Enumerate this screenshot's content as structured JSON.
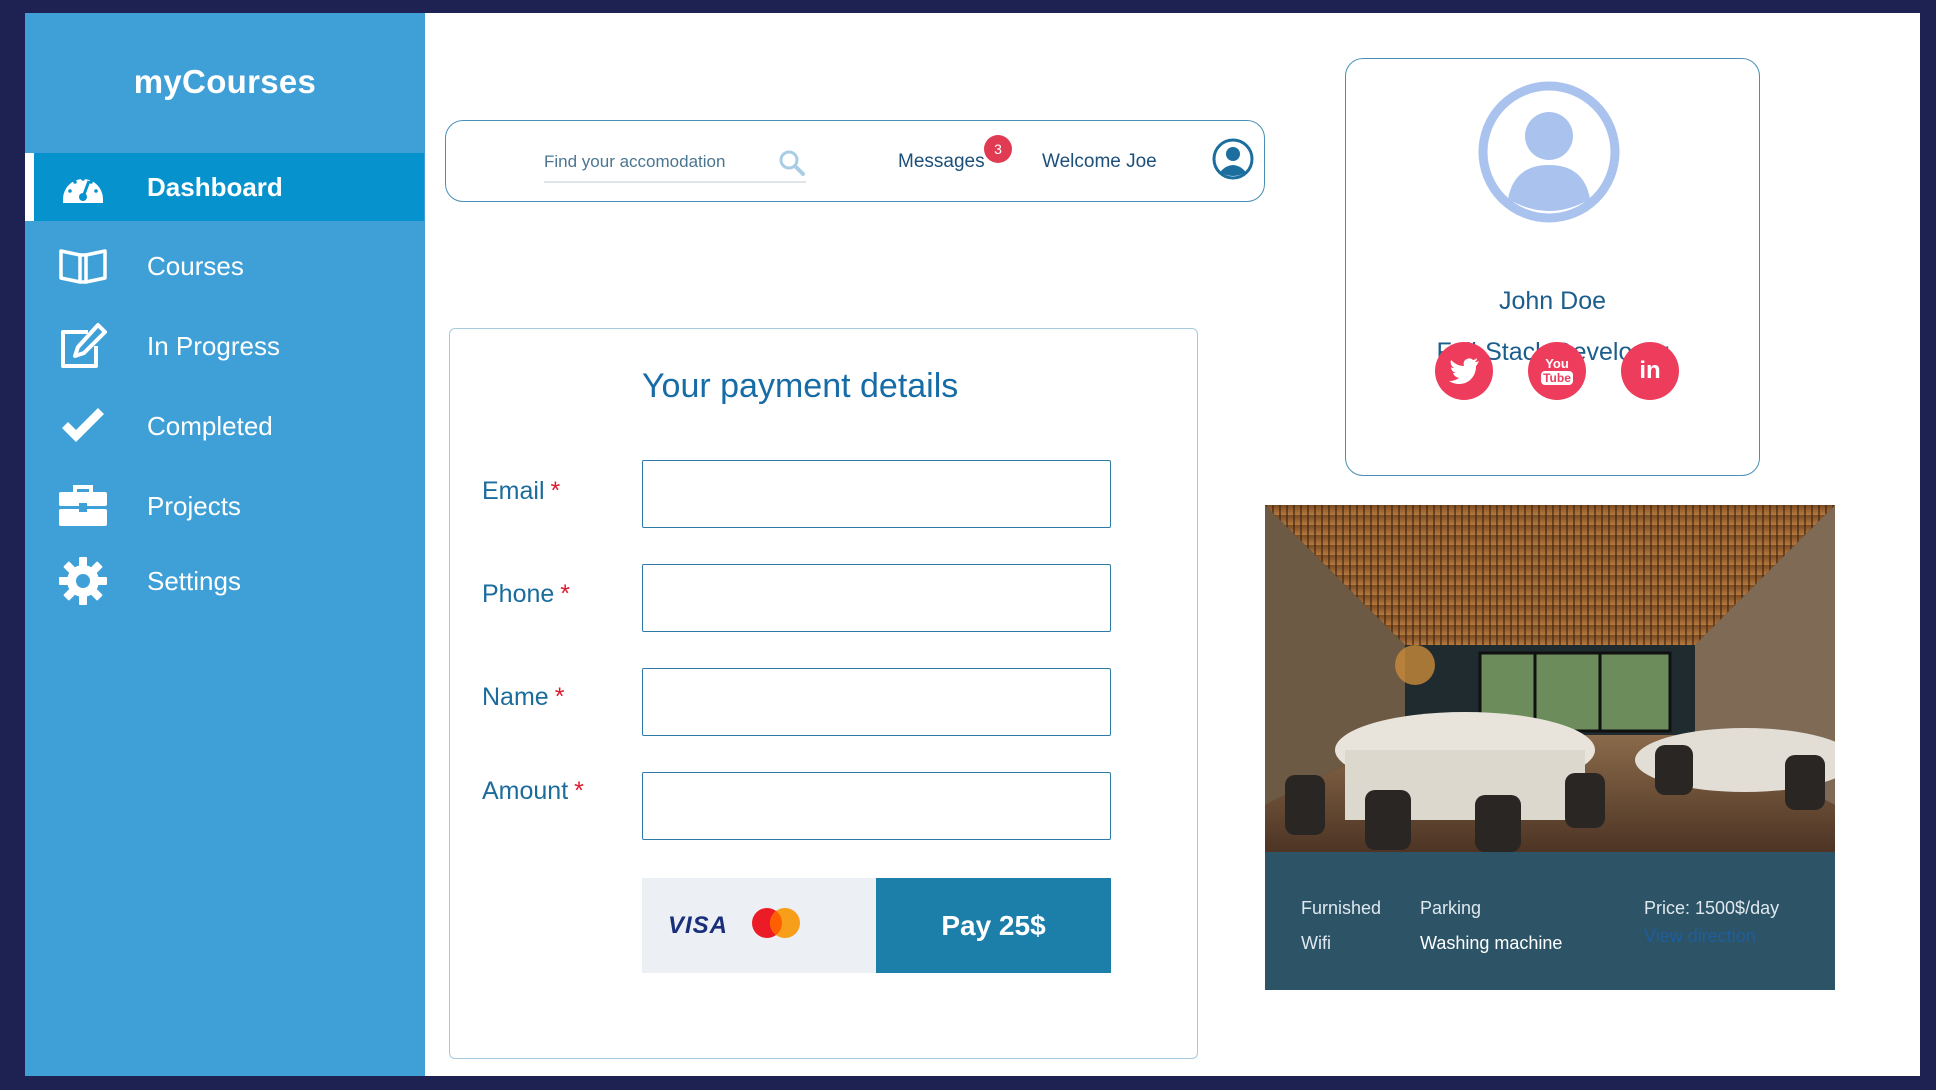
{
  "brand": "myCourses",
  "sidebar": {
    "items": [
      {
        "label": "Dashboard",
        "icon": "dashboard-gauge-icon",
        "active": true
      },
      {
        "label": "Courses",
        "icon": "book-icon",
        "active": false
      },
      {
        "label": "In Progress",
        "icon": "edit-icon",
        "active": false
      },
      {
        "label": "Completed",
        "icon": "checkmark-icon",
        "active": false
      },
      {
        "label": "Projects",
        "icon": "briefcase-icon",
        "active": false
      },
      {
        "label": "Settings",
        "icon": "gear-icon",
        "active": false
      }
    ]
  },
  "topbar": {
    "search_placeholder": "Find your accomodation",
    "messages_label": "Messages",
    "messages_count": "3",
    "welcome": "Welcome Joe"
  },
  "payment": {
    "title": "Your payment details",
    "fields": [
      {
        "label": "Email",
        "required_mark": "*",
        "value": ""
      },
      {
        "label": "Phone",
        "required_mark": "*",
        "value": ""
      },
      {
        "label": "Name",
        "required_mark": "*",
        "value": ""
      },
      {
        "label": "Amount",
        "required_mark": "*",
        "value": ""
      }
    ],
    "visa_label": "VISA",
    "pay_label": "Pay 25$"
  },
  "profile": {
    "name": "John Doe",
    "role": "Full-Stack Developer",
    "social": [
      "twitter-icon",
      "youtube-icon",
      "linkedin-icon"
    ],
    "youtube_text_top": "You",
    "youtube_text_bottom": "Tube",
    "linkedin_text": "in"
  },
  "accommodation": {
    "amenities": {
      "furnished": "Furnished",
      "parking": "Parking",
      "wifi": "Wifi",
      "washing": "Washing machine"
    },
    "price": "Price: 1500$/day",
    "view_direction": "View direction"
  },
  "colors": {
    "sidebar": "#3fa0d8",
    "sidebar_active": "#0592cd",
    "accent": "#1c7faa",
    "badge": "#e13b53",
    "social": "#ee3c5c",
    "frame_bg": "#1e2252"
  }
}
